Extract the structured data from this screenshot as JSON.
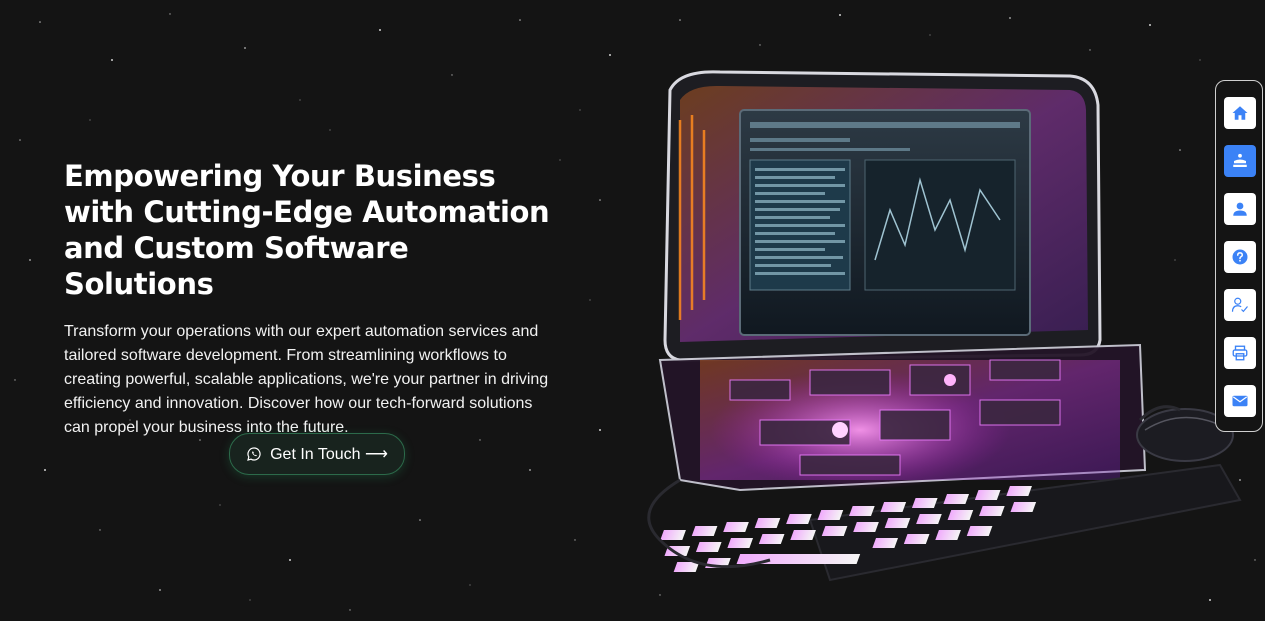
{
  "hero": {
    "title": "Empowering Your Business with Cutting-Edge Automation and Custom Software Solutions",
    "description": "Transform your operations with our expert automation services and tailored software development. From streamlining workflows to creating powerful, scalable applications, we're your partner in driving efficiency and innovation. Discover how our tech-forward solutions can propel your business into the future.",
    "cta_label": "Get In Touch ⟶",
    "cta_icon": "whatsapp-icon"
  },
  "side_nav": {
    "items": [
      {
        "icon": "home-icon",
        "active": false
      },
      {
        "icon": "services-icon",
        "active": true
      },
      {
        "icon": "user-icon",
        "active": false
      },
      {
        "icon": "help-icon",
        "active": false
      },
      {
        "icon": "user-check-icon",
        "active": false
      },
      {
        "icon": "print-icon",
        "active": false
      },
      {
        "icon": "mail-icon",
        "active": false
      }
    ]
  },
  "colors": {
    "background": "#141414",
    "accent": "#3b82f6",
    "cta_border": "#2c6a4a",
    "neon_pink": "#e04bff"
  }
}
